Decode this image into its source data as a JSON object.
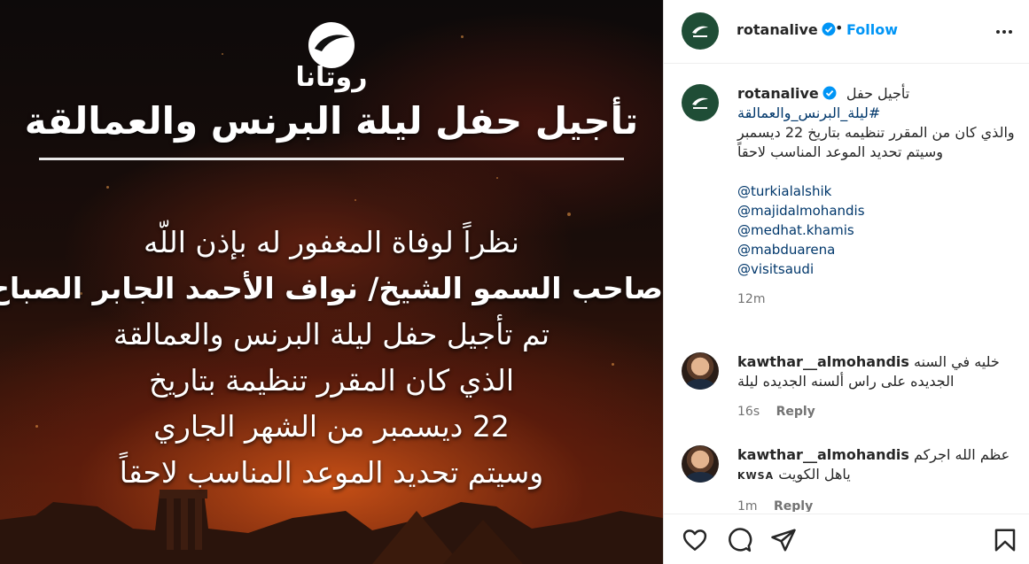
{
  "media": {
    "logo_word": "روتانا",
    "title": "تأجيل حفل ليلة البرنس والعمالقة",
    "lines": [
      {
        "text": "نظراً لوفاة المغفور له بإذن اللّه",
        "bold": false
      },
      {
        "text": "صاحب السمو الشيخ/ نواف الأحمد الجابر الصباح",
        "bold": true
      },
      {
        "text": "تم تأجيل حفل ليلة البرنس والعمالقة",
        "bold": false
      },
      {
        "text": "الذي كان المقرر تنظيمة بتاريخ",
        "bold": false
      },
      {
        "text": "22 ديسمبر من الشهر الجاري",
        "bold": false
      },
      {
        "text": "وسيتم تحديد الموعد المناسب لاحقاً",
        "bold": false
      }
    ]
  },
  "header": {
    "username": "rotanalive",
    "dot": "•",
    "follow_label": "Follow"
  },
  "caption": {
    "username": "rotanalive",
    "title": "تأجيل حفل",
    "hashtag": "#ليلة_البرنس_والعمالقة",
    "line1": "والذي كان من المقرر تنظيمه بتاريخ 22 ديسمبر",
    "line2": "وسيتم تحديد الموعد المناسب لاحقاً",
    "mentions": [
      "@turkialalshik",
      "@majidalmohandis",
      "@medhat.khamis",
      "@mabduarena",
      "@visitsaudi"
    ],
    "time": "12m"
  },
  "comments": [
    {
      "username": "kawthar__almohandis",
      "text": "خليه في السنه الجديده على راس ألسنه الجديده ليلة",
      "time": "16s",
      "reply_label": "Reply"
    },
    {
      "username": "kawthar__almohandis",
      "text": "عظم الله اجركم",
      "text2": "ياهل الكويت",
      "badge": "KWSA",
      "time": "1m",
      "reply_label": "Reply"
    }
  ],
  "icons": {
    "like": "heart-icon",
    "comment": "comment-icon",
    "share": "paper-plane-icon",
    "save": "bookmark-icon",
    "more": "more-horizontal-icon",
    "verified": "verified-badge-icon"
  },
  "colors": {
    "brand_avatar": "#1f4d36",
    "follow": "#0095f6",
    "link": "#00376b",
    "verified": "#0095f6",
    "muted": "#737373"
  }
}
